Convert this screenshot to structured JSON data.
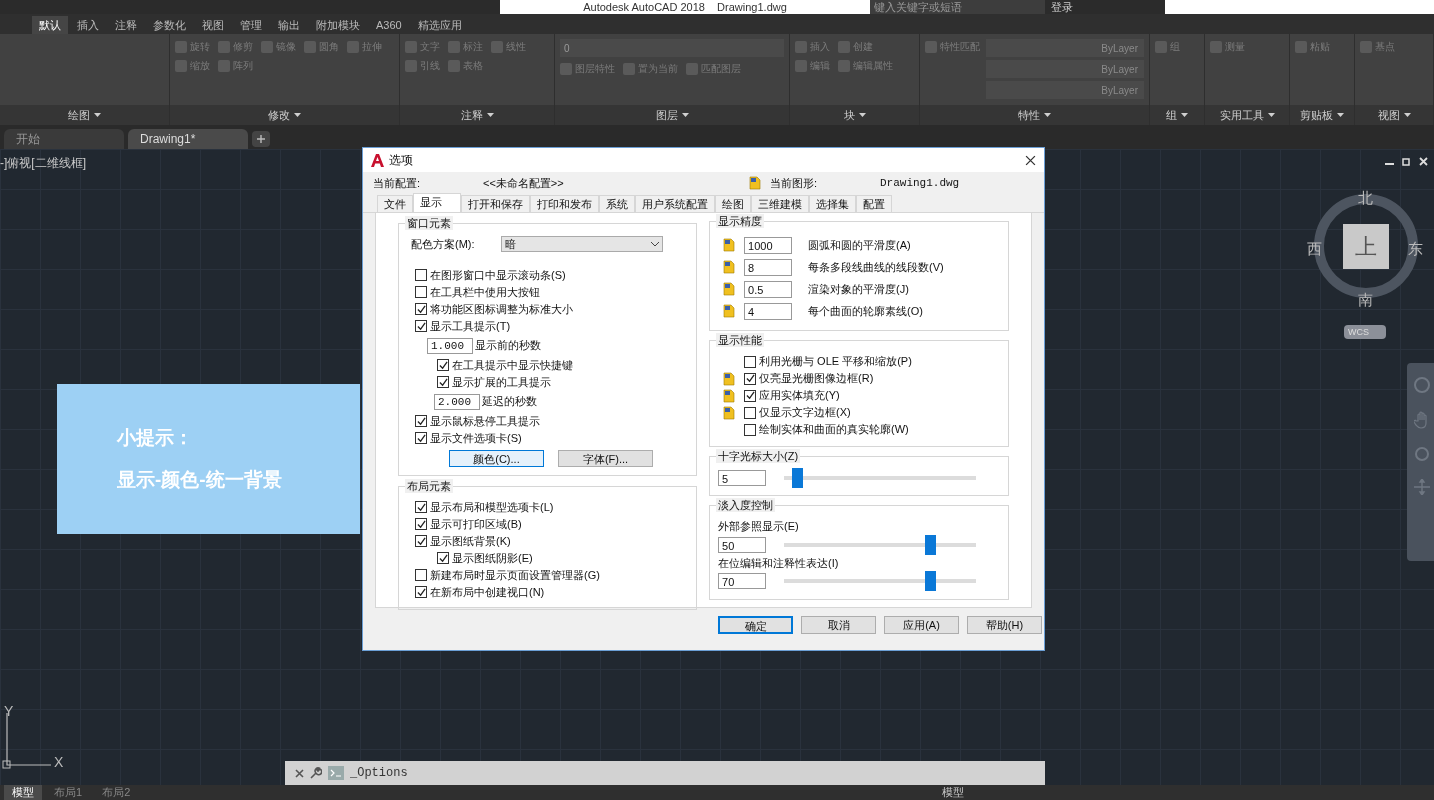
{
  "title_bar": {
    "title": "Autodesk AutoCAD 2018    Drawing1.dwg",
    "search": {
      "placeholder": "键入关键字或短语"
    },
    "sign_in": "登录"
  },
  "ribbon_tabs": [
    {
      "label": "默认",
      "selected": true
    },
    {
      "label": "插入",
      "selected": false
    },
    {
      "label": "注释",
      "selected": false
    },
    {
      "label": "参数化",
      "selected": false
    },
    {
      "label": "视图",
      "selected": false
    },
    {
      "label": "管理",
      "selected": false
    },
    {
      "label": "输出",
      "selected": false
    },
    {
      "label": "附加模块",
      "selected": false
    },
    {
      "label": "A360",
      "selected": false
    },
    {
      "label": "精选应用",
      "selected": false
    }
  ],
  "ribbon_panels": [
    {
      "title": "绘图",
      "kind": "tools"
    },
    {
      "title": "修改",
      "kind": "tools",
      "tools": [
        "旋转",
        "修剪",
        "镜像",
        "圆角",
        "拉伸",
        "缩放",
        "阵列"
      ]
    },
    {
      "title": "注释",
      "kind": "tools",
      "tools": [
        "文字",
        "标注",
        "线性",
        "引线",
        "表格"
      ]
    },
    {
      "title": "图层",
      "kind": "layer",
      "layer": "0",
      "tools": [
        "图层特性",
        "置为当前",
        "匹配图层"
      ]
    },
    {
      "title": "块",
      "kind": "tools",
      "tools": [
        "插入",
        "创建",
        "编辑",
        "编辑属性"
      ]
    },
    {
      "title": "特性",
      "kind": "properties",
      "tools": [
        "特性匹配"
      ],
      "dropdowns": [
        "ByLayer",
        "ByLayer",
        "ByLayer"
      ]
    },
    {
      "title": "组",
      "kind": "tools",
      "tools": [
        "组"
      ]
    },
    {
      "title": "实用工具",
      "kind": "tools",
      "tools": [
        "测量"
      ]
    },
    {
      "title": "剪贴板",
      "kind": "tools",
      "tools": [
        "粘贴"
      ]
    },
    {
      "title": "视图",
      "kind": "tools",
      "tools": [
        "基点"
      ]
    }
  ],
  "file_tabs": [
    {
      "label": "开始",
      "selected": false
    },
    {
      "label": "Drawing1*",
      "selected": true
    }
  ],
  "viewport_label": "-]俯视[二维线框]",
  "viewcube": {
    "north": "北",
    "south": "南",
    "west": "西",
    "east": "东",
    "face": "上",
    "ucs": "WCS"
  },
  "tip": {
    "title": "小提示：",
    "text": "显示-颜色-统一背景"
  },
  "dialog": {
    "title": "选项",
    "profile_label": "当前配置:",
    "profile": "<<未命名配置>>",
    "drawing_label": "当前图形:",
    "drawing": "Drawing1.dwg",
    "tabs": [
      {
        "label": "文件",
        "selected": false
      },
      {
        "label": "显示",
        "selected": true
      },
      {
        "label": "打开和保存",
        "selected": false
      },
      {
        "label": "打印和发布",
        "selected": false
      },
      {
        "label": "系统",
        "selected": false
      },
      {
        "label": "用户系统配置",
        "selected": false
      },
      {
        "label": "绘图",
        "selected": false
      },
      {
        "label": "三维建模",
        "selected": false
      },
      {
        "label": "选择集",
        "selected": false
      },
      {
        "label": "配置",
        "selected": false
      }
    ],
    "window_elements": {
      "title": "窗口元素",
      "scheme_label": "配色方案(M):",
      "scheme": "暗",
      "items": [
        {
          "kind": "checkbox",
          "label": "在图形窗口中显示滚动条(S)",
          "checked": false
        },
        {
          "kind": "checkbox",
          "label": "在工具栏中使用大按钮",
          "checked": false
        },
        {
          "kind": "checkbox",
          "label": "将功能区图标调整为标准大小",
          "checked": true
        },
        {
          "kind": "checkbox",
          "label": "显示工具提示(T)",
          "checked": true,
          "children": [
            {
              "kind": "number",
              "value": "1.000",
              "suffix": "显示前的秒数"
            },
            {
              "kind": "checkbox",
              "label": "在工具提示中显示快捷键",
              "checked": true
            },
            {
              "kind": "checkbox",
              "label": "显示扩展的工具提示",
              "checked": true
            },
            {
              "kind": "number",
              "value": "2.000",
              "suffix": "延迟的秒数"
            }
          ]
        },
        {
          "kind": "checkbox",
          "label": "显示鼠标悬停工具提示",
          "checked": true
        },
        {
          "kind": "checkbox",
          "label": "显示文件选项卡(S)",
          "checked": true
        }
      ],
      "buttons": [
        {
          "label": "颜色(C)...",
          "focused": true
        },
        {
          "label": "字体(F)...",
          "focused": false
        }
      ]
    },
    "layout_elements": {
      "title": "布局元素",
      "items": [
        {
          "kind": "checkbox",
          "label": "显示布局和模型选项卡(L)",
          "checked": true
        },
        {
          "kind": "checkbox",
          "label": "显示可打印区域(B)",
          "checked": true
        },
        {
          "kind": "checkbox",
          "label": "显示图纸背景(K)",
          "checked": true,
          "children": [
            {
              "kind": "checkbox",
              "label": "显示图纸阴影(E)",
              "checked": true
            }
          ]
        },
        {
          "kind": "checkbox",
          "label": "新建布局时显示页面设置管理器(G)",
          "checked": false
        },
        {
          "kind": "checkbox",
          "label": "在新布局中创建视口(N)",
          "checked": true
        }
      ]
    },
    "precision": {
      "title": "显示精度",
      "rows": [
        {
          "value": "1000",
          "label": "圆弧和圆的平滑度(A)"
        },
        {
          "value": "8",
          "label": "每条多段线曲线的线段数(V)"
        },
        {
          "value": "0.5",
          "label": "渲染对象的平滑度(J)"
        },
        {
          "value": "4",
          "label": "每个曲面的轮廓素线(O)"
        }
      ]
    },
    "performance": {
      "title": "显示性能",
      "rows": [
        {
          "label": "利用光栅与 OLE 平移和缩放(P)",
          "checked": false,
          "saved_in_drawing": false
        },
        {
          "label": "仅亮显光栅图像边框(R)",
          "checked": true,
          "saved_in_drawing": true
        },
        {
          "label": "应用实体填充(Y)",
          "checked": true,
          "saved_in_drawing": true
        },
        {
          "label": "仅显示文字边框(X)",
          "checked": false,
          "saved_in_drawing": true
        },
        {
          "label": "绘制实体和曲面的真实轮廓(W)",
          "checked": false,
          "saved_in_drawing": false
        }
      ]
    },
    "crosshair": {
      "title": "十字光标大小(Z)",
      "value": "5",
      "level": 0.07
    },
    "fade": {
      "title": "淡入度控制",
      "sliders": [
        {
          "label": "外部参照显示(E)",
          "value": "50",
          "level": 0.76
        },
        {
          "label": "在位编辑和注释性表达(I)",
          "value": "70",
          "level": 0.76
        }
      ]
    },
    "buttons": [
      {
        "label": "确定",
        "default": true
      },
      {
        "label": "取消",
        "default": false
      },
      {
        "label": "应用(A)",
        "default": false
      },
      {
        "label": "帮助(H)",
        "default": false
      }
    ]
  },
  "command_line": {
    "value": "_Options"
  },
  "axes": {
    "y": "Y",
    "x": "X"
  },
  "layout_tabs": [
    {
      "label": "模型",
      "selected": true
    },
    {
      "label": "布局1",
      "selected": false
    },
    {
      "label": "布局2",
      "selected": false
    }
  ],
  "status_bar": {
    "space": "模型"
  }
}
